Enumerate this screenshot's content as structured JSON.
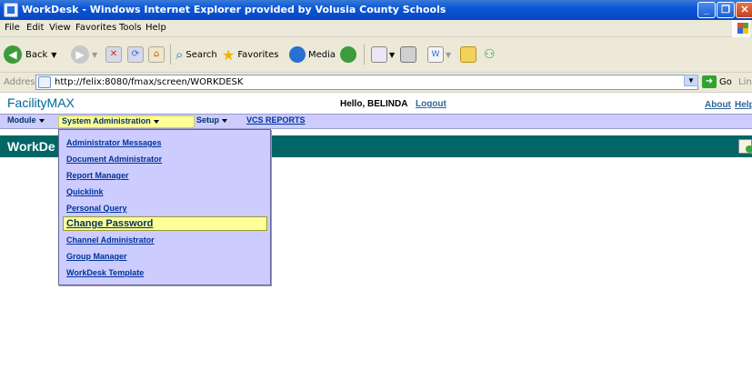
{
  "window": {
    "title": "WorkDesk - Windows Internet Explorer provided by Volusia County Schools"
  },
  "menubar": {
    "items": [
      "File",
      "Edit",
      "View",
      "Favorites",
      "Tools",
      "Help"
    ]
  },
  "toolbar": {
    "back_label": "Back",
    "search_label": "Search",
    "favorites_label": "Favorites",
    "media_label": "Media"
  },
  "address": {
    "label": "Address",
    "url": "http://felix:8080/fmax/screen/WORKDESK",
    "go_label": "Go",
    "links_label": "Lin"
  },
  "app": {
    "brand": "FacilityMAX",
    "greeting": "Hello, BELINDA",
    "logout": "Logout",
    "about": "About",
    "help": "Help"
  },
  "nav": {
    "module": "Module",
    "system_admin": "System Administration",
    "setup": "Setup",
    "vcs_reports": "VCS REPORTS"
  },
  "subheader": {
    "title": "WorkDe"
  },
  "dropdown": {
    "items": [
      "Administrator Messages",
      "Document Administrator",
      "Report Manager",
      "Quicklink",
      "Personal Query",
      "Change Password",
      "Channel Administrator",
      "Group Manager",
      "WorkDesk Template"
    ],
    "highlighted": "Change Password"
  },
  "colors": {
    "titlebar": "#0a56d8",
    "nav_bg": "#ccccff",
    "subheader_bg": "#006666",
    "highlight": "#ffff99",
    "link": "#003399"
  }
}
